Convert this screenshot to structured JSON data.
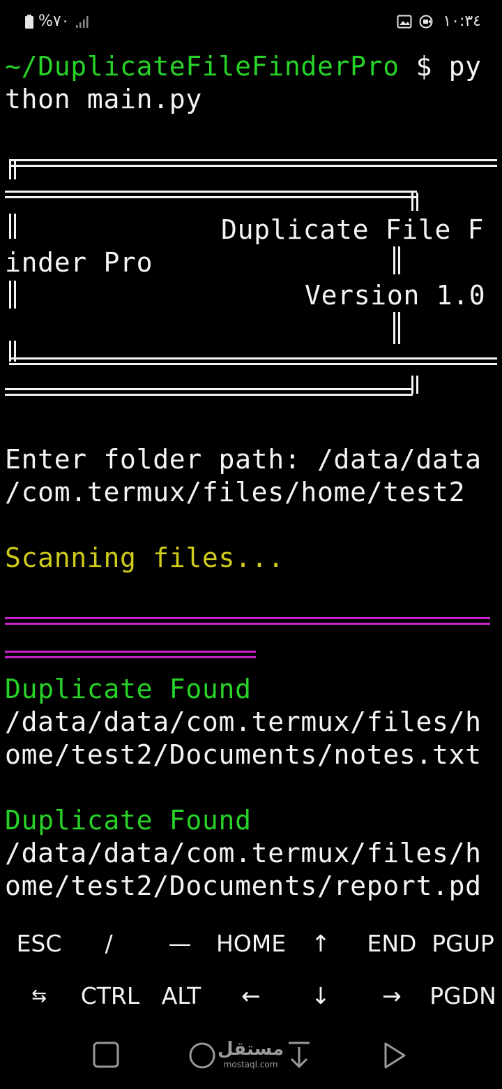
{
  "status_bar": {
    "battery": "%٧٠",
    "time": "١٠:٣٤",
    "icons": [
      "battery-icon",
      "signal-icon",
      "gallery-icon",
      "screen-record-icon"
    ]
  },
  "terminal": {
    "prompt_path": "~/DuplicateFileFinderPro",
    "prompt_symbol": " $ ",
    "command_part1": "py",
    "command_part2": "thon main.py",
    "banner_title_part1": "Duplicate File F",
    "banner_title_part2": "inder Pro",
    "banner_version": "Version 1.0",
    "input_prompt_part1": "Enter folder path: /data/data",
    "input_prompt_part2": "/com.termux/files/home/test2",
    "scanning": "Scanning files...",
    "results": [
      {
        "heading": "Duplicate Found",
        "path_part1": "/data/data/com.termux/files/h",
        "path_part2": "ome/test2/Documents/notes.txt"
      },
      {
        "heading": "Duplicate Found",
        "path_part1": "/data/data/com.termux/files/h",
        "path_part2": "ome/test2/Documents/report.pd"
      }
    ],
    "colors": {
      "green": "#28d228",
      "yellow": "#d0cc1a",
      "magenta": "#cc22cc",
      "white": "#f4f4f4"
    }
  },
  "extra_keys": {
    "row1": [
      "ESC",
      "/",
      "—",
      "HOME",
      "↑",
      "END",
      "PGUP"
    ],
    "row2": [
      "⇆",
      "CTRL",
      "ALT",
      "←",
      "↓",
      "→",
      "PGDN"
    ]
  },
  "nav_bar": {
    "watermark_main": "مستقل",
    "watermark_sub": "mostaql.com",
    "icons": [
      "square-recents-icon",
      "circle-home-icon",
      "arrow-down-hide-keyboard-icon",
      "triangle-back-icon"
    ]
  }
}
